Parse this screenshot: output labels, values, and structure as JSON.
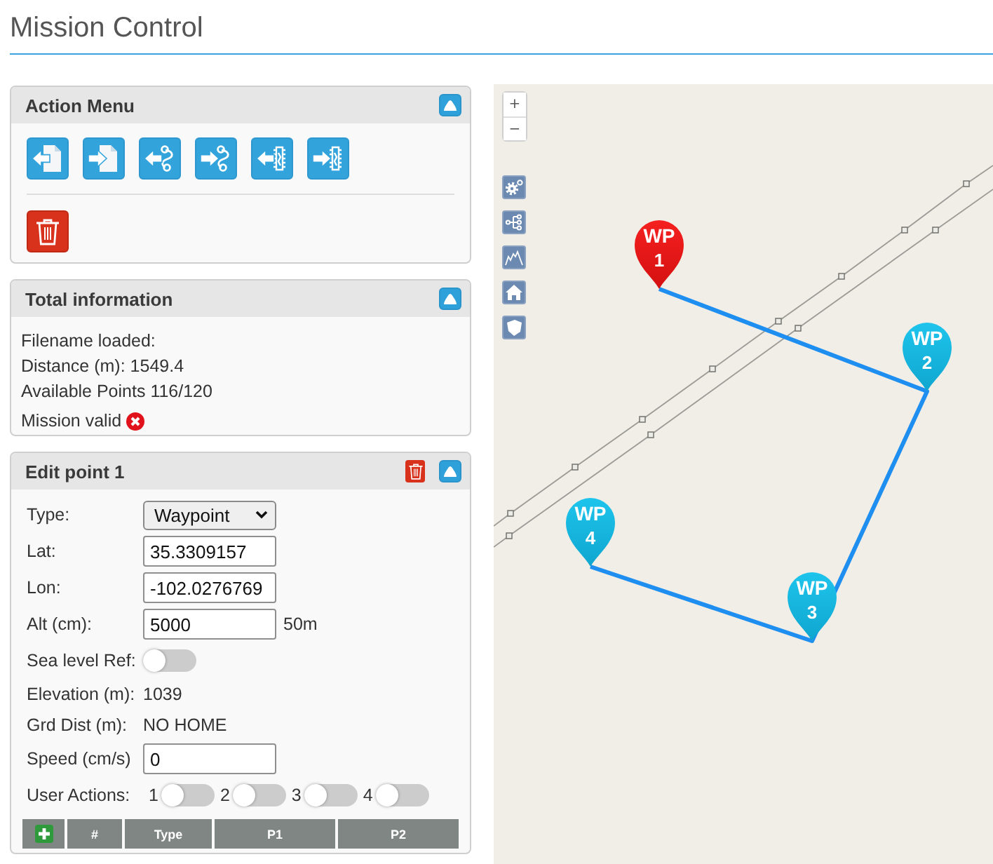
{
  "page": {
    "title": "Mission Control"
  },
  "action_menu": {
    "title": "Action Menu"
  },
  "total_information": {
    "title": "Total information",
    "lines": [
      "Filename loaded:",
      "Distance (m): 1549.4",
      "Available Points 116/120"
    ],
    "mission_valid": {
      "label": "Mission valid",
      "valid": false
    }
  },
  "edit_point": {
    "title": "Edit point 1",
    "fields": [
      {
        "kind": "select",
        "label": "Type:",
        "value": "Waypoint"
      },
      {
        "kind": "input",
        "label": "Lat:",
        "value": "35.3309157"
      },
      {
        "kind": "input",
        "label": "Lon:",
        "value": "-102.0276769"
      },
      {
        "kind": "input",
        "label": "Alt (cm):",
        "value": "5000",
        "unit": "50m"
      },
      {
        "kind": "toggle",
        "label": "Sea level Ref:",
        "on": false
      },
      {
        "kind": "text",
        "label": "Elevation (m):",
        "value": "1039"
      },
      {
        "kind": "text",
        "label": "Grd Dist (m):",
        "value": "NO HOME"
      },
      {
        "kind": "input",
        "label": "Speed (cm/s)",
        "value": "0"
      }
    ],
    "user_actions": {
      "label": "User Actions:",
      "actions": [
        {
          "label": "1",
          "on": false
        },
        {
          "label": "2",
          "on": false
        },
        {
          "label": "3",
          "on": false
        },
        {
          "label": "4",
          "on": false
        }
      ]
    },
    "table": {
      "columns": [
        "#",
        "Type",
        "P1",
        "P2"
      ]
    }
  },
  "map": {
    "zoom_in": "+",
    "zoom_out": "−",
    "markers": [
      {
        "label": "WP",
        "number": "1",
        "selected": true
      },
      {
        "label": "WP",
        "number": "2",
        "selected": false
      },
      {
        "label": "WP",
        "number": "3",
        "selected": false
      },
      {
        "label": "WP",
        "number": "4",
        "selected": false
      }
    ]
  }
}
